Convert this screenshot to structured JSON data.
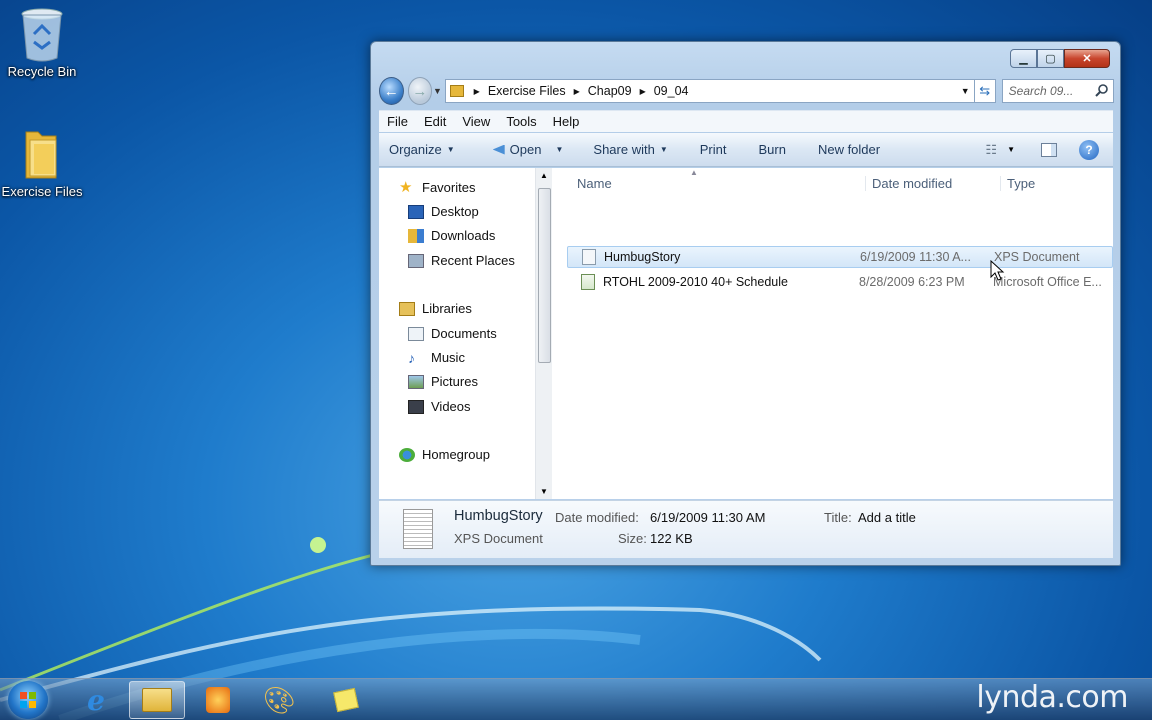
{
  "desktop": {
    "icons": [
      {
        "label": "Recycle Bin"
      },
      {
        "label": "Exercise Files"
      }
    ]
  },
  "window": {
    "breadcrumb": [
      "Exercise Files",
      "Chap09",
      "09_04"
    ],
    "search_placeholder": "Search 09...",
    "menu": [
      "File",
      "Edit",
      "View",
      "Tools",
      "Help"
    ],
    "commands": {
      "organize": "Organize",
      "open": "Open",
      "share_with": "Share with",
      "print": "Print",
      "burn": "Burn",
      "new_folder": "New folder"
    },
    "nav_pane": {
      "favorites": "Favorites",
      "desktop": "Desktop",
      "downloads": "Downloads",
      "recent_places": "Recent Places",
      "libraries": "Libraries",
      "documents": "Documents",
      "music": "Music",
      "pictures": "Pictures",
      "videos": "Videos",
      "homegroup": "Homegroup"
    },
    "columns": {
      "name": "Name",
      "date_modified": "Date modified",
      "type": "Type"
    },
    "files": [
      {
        "name": "HumbugStory",
        "date": "6/19/2009 11:30 A...",
        "type": "XPS Document",
        "selected": true
      },
      {
        "name": "RTOHL 2009-2010 40+ Schedule",
        "date": "8/28/2009 6:23 PM",
        "type": "Microsoft Office E...",
        "selected": false
      }
    ],
    "details": {
      "name": "HumbugStory",
      "kind": "XPS Document",
      "date_label": "Date modified:",
      "date_value": "6/19/2009 11:30 AM",
      "size_label": "Size:",
      "size_value": "122 KB",
      "title_label": "Title:",
      "title_value": "Add a title"
    }
  },
  "watermark": "lynda.com",
  "colors": {
    "selection": "#d3e6f8",
    "command_text": "#1e395b",
    "desktop": "#1f7ccc"
  }
}
